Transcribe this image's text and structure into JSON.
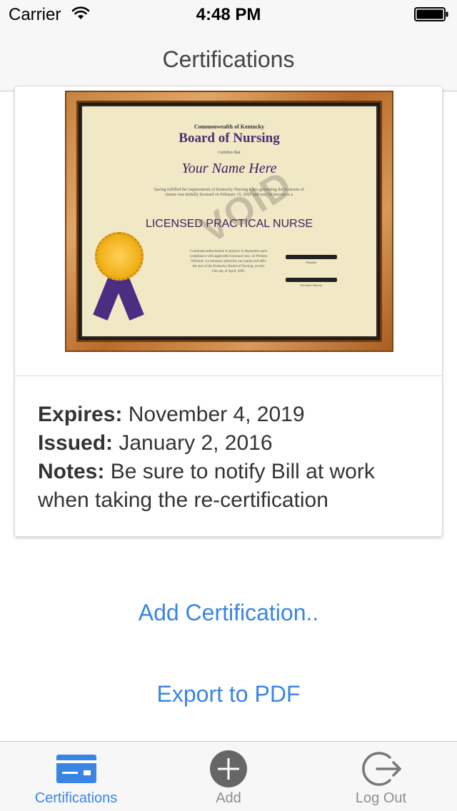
{
  "status_bar": {
    "carrier": "Carrier",
    "time": "4:48 PM"
  },
  "nav": {
    "title": "Certifications"
  },
  "certificate": {
    "commonwealth": "Commonwealth of Kentucky",
    "board": "Board of Nursing",
    "certifies": "Certifies that",
    "name": "Your Name Here",
    "fine_print": "having fulfilled the requirements of Kentucky Nursing Laws governing the licensure of nurses was initially licensed on February 15, 2005 and may be known as a",
    "title": "LICENSED PRACTICAL NURSE",
    "watermark": "VOID",
    "small_text": "Continued authorization to practice is dependent upon compliance with applicable licensure laws. In Witness Whereof, we hereunto subscribe our names and affix the seal of the Kentucky Board of Nursing, on this 15th day of April, 2005.",
    "sig1_label": "President",
    "sig2_label": "Executive Director"
  },
  "details": {
    "expires_label": "Expires:",
    "expires_value": "November 4, 2019",
    "issued_label": "Issued:",
    "issued_value": "January 2, 2016",
    "notes_label": "Notes:",
    "notes_value": "Be sure to notify Bill at work when taking the re-certification"
  },
  "actions": {
    "add_certification": "Add Certification..",
    "export_pdf": "Export to PDF"
  },
  "tabs": [
    {
      "label": "Certifications",
      "icon": "credit-card-icon",
      "active": true
    },
    {
      "label": "Add",
      "icon": "plus-circle-icon",
      "active": false
    },
    {
      "label": "Log Out",
      "icon": "logout-icon",
      "active": false
    }
  ],
  "colors": {
    "accent": "#3a85e4",
    "inactive_tab": "#8e8e8e",
    "bar_background": "#f7f7f7"
  }
}
